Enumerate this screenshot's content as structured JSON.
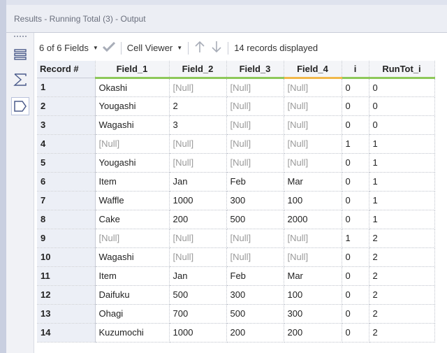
{
  "window": {
    "title": "Results - Running Total (3) - Output"
  },
  "toolbar": {
    "fields_label": "6 of 6 Fields",
    "cell_viewer_label": "Cell Viewer",
    "records_label": "14 records displayed"
  },
  "side_rail": {
    "icons": [
      "list-view-icon",
      "sigma-icon",
      "tag-icon"
    ]
  },
  "table": {
    "columns": [
      "Record #",
      "Field_1",
      "Field_2",
      "Field_3",
      "Field_4",
      "i",
      "RunTot_i"
    ],
    "rows": [
      [
        "1",
        "Okashi",
        "[Null]",
        "[Null]",
        "[Null]",
        "0",
        "0"
      ],
      [
        "2",
        "Yougashi",
        "2",
        "[Null]",
        "[Null]",
        "0",
        "0"
      ],
      [
        "3",
        "Wagashi",
        "3",
        "[Null]",
        "[Null]",
        "0",
        "0"
      ],
      [
        "4",
        "[Null]",
        "[Null]",
        "[Null]",
        "[Null]",
        "1",
        "1"
      ],
      [
        "5",
        "Yougashi",
        "[Null]",
        "[Null]",
        "[Null]",
        "0",
        "1"
      ],
      [
        "6",
        "Item",
        "Jan",
        "Feb",
        "Mar",
        "0",
        "1"
      ],
      [
        "7",
        "Waffle",
        "1000",
        "300",
        "100",
        "0",
        "1"
      ],
      [
        "8",
        "Cake",
        "200",
        "500",
        "2000",
        "0",
        "1"
      ],
      [
        "9",
        "[Null]",
        "[Null]",
        "[Null]",
        "[Null]",
        "1",
        "2"
      ],
      [
        "10",
        "Wagashi",
        "[Null]",
        "[Null]",
        "[Null]",
        "0",
        "2"
      ],
      [
        "11",
        "Item",
        "Jan",
        "Feb",
        "Mar",
        "0",
        "2"
      ],
      [
        "12",
        "Daifuku",
        "500",
        "300",
        "100",
        "0",
        "2"
      ],
      [
        "13",
        "Ohagi",
        "700",
        "500",
        "300",
        "0",
        "2"
      ],
      [
        "14",
        "Kuzumochi",
        "1000",
        "200",
        "200",
        "0",
        "2"
      ]
    ]
  }
}
